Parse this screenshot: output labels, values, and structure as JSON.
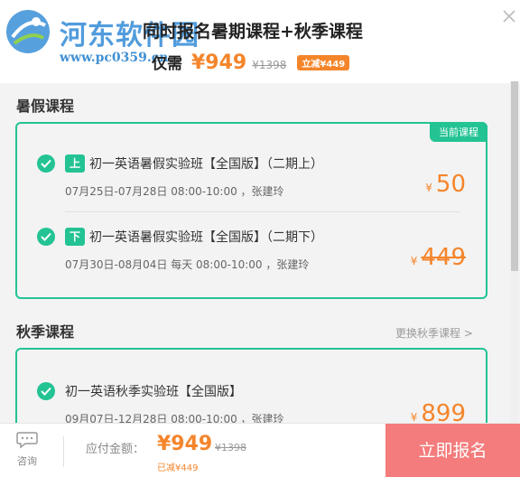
{
  "watermark": {
    "title": "河东软件园",
    "url": "www.pc0359.cn"
  },
  "header": {
    "title": "同时报名暑期课程+秋季课程",
    "price_label": "仅需",
    "price": "¥949",
    "original_price": "¥1398",
    "discount": "立减¥449"
  },
  "summer": {
    "section_title": "暑假课程",
    "current_badge": "当前课程",
    "courses": [
      {
        "tag": "上",
        "name": "初一英语暑假实验班【全国版】（二期上）",
        "time": "07月25日-07月28日 08:00-10:00 ，张建玲",
        "yen": "¥",
        "price": "50"
      },
      {
        "tag": "下",
        "name": "初一英语暑假实验班【全国版】（二期下）",
        "time": "07月30日-08月04日 每天 08:00-10:00 ，张建玲",
        "yen": "¥",
        "price": "449"
      }
    ]
  },
  "autumn": {
    "section_title": "秋季课程",
    "change_link": "更换秋季课程 >",
    "courses": [
      {
        "name": "初一英语秋季实验班【全国版】",
        "time": "09月07日-12月28日 08:00-10:00 ，张建玲",
        "yen": "¥",
        "price": "899"
      }
    ]
  },
  "footer": {
    "consult_label": "咨询",
    "pay_label": "应付金额：",
    "pay_amount": "¥949",
    "pay_original": "¥1398",
    "saved": "已减¥449",
    "signup_button": "立即报名"
  },
  "colors": {
    "accent": "#23c394",
    "price": "#f5852b",
    "signup": "#f47c7c"
  }
}
